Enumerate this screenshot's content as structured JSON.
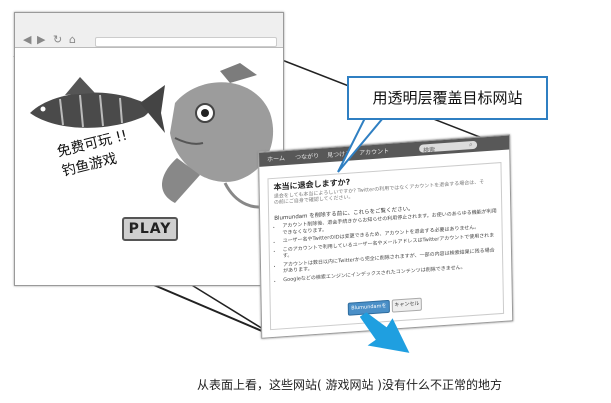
{
  "callout": {
    "text": "用透明层覆盖目标网站"
  },
  "caption": {
    "text": "从表面上看，这些网站( 游戏网站 )没有什么不正常的地方"
  },
  "game_page": {
    "tagline_line1": "免费可玩 !!",
    "tagline_line2": "钓鱼游戏",
    "play_label": "PLAY"
  },
  "fg_page": {
    "toolbar_items": [
      "ホーム",
      "つながり",
      "見つける",
      "アカウント"
    ],
    "search_placeholder": "検索",
    "title": "本当に退会しますか?",
    "subtitle": "退会をしても本当によろしいですか? Twitterの利用ではなくアカウントを退会する場合は、その前にご自身で確認してください。",
    "intro": "Blumundam を削除する前に、これらをご覧ください。",
    "bullets": [
      "アカウント削除後、退会手続きからお知らせの利用停止されます。お使いのあらゆる機能が利用できなくなります。",
      "ユーザー名やTwitterのIDは変更できるため、アカウントを退会する必要はありません。",
      "このアカウントで利用しているユーザー名やメールアドレスはTwitterアカウントで使用されます。",
      "アカウントは数日以内にTwitterから完全に削除されますが、一部の内容は検索結果に残る場合があります。",
      "Googleなどの検索エンジンにインデックスされたコンテンツは削除できません。"
    ],
    "ok_label": "Blumundamを削除",
    "cancel_label": "キャンセル"
  },
  "colors": {
    "accent": "#2f7fc2",
    "arrow": "#1f9fe0",
    "toolbar": "#585858"
  }
}
